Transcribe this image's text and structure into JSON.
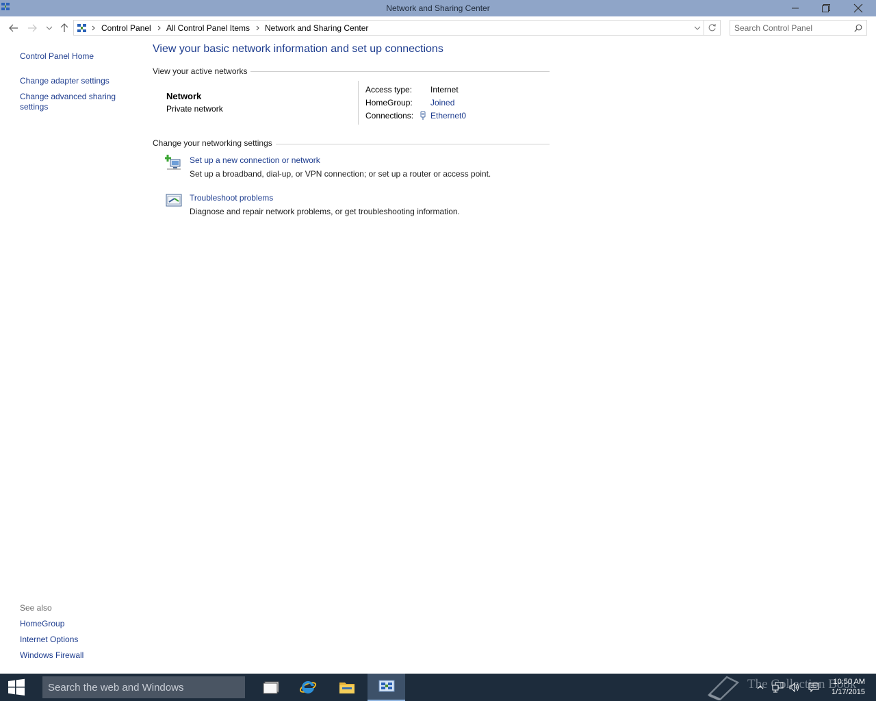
{
  "window": {
    "title": "Network and Sharing Center"
  },
  "address": {
    "crumbs": [
      "Control Panel",
      "All Control Panel Items",
      "Network and Sharing Center"
    ]
  },
  "search": {
    "placeholder": "Search Control Panel"
  },
  "leftnav": {
    "home": "Control Panel Home",
    "adapter": "Change adapter settings",
    "advanced_line1": "Change advanced sharing",
    "advanced_line2": "settings"
  },
  "seealso": {
    "header": "See also",
    "items": [
      "HomeGroup",
      "Internet Options",
      "Windows Firewall"
    ]
  },
  "main": {
    "title": "View your basic network information and set up connections",
    "active_header": "View your active networks",
    "network_name": "Network",
    "network_type": "Private network",
    "access_label": "Access type:",
    "access_value": "Internet",
    "homegroup_label": "HomeGroup:",
    "homegroup_value": "Joined",
    "connections_label": "Connections:",
    "connections_value": "Ethernet0",
    "change_header": "Change your networking settings",
    "tasks": [
      {
        "link": "Set up a new connection or network",
        "desc": "Set up a broadband, dial-up, or VPN connection; or set up a router or access point."
      },
      {
        "link": "Troubleshoot problems",
        "desc": "Diagnose and repair network problems, or get troubleshooting information."
      }
    ]
  },
  "taskbar": {
    "search_placeholder": "Search the web and Windows",
    "watermark": "The Collection Book",
    "time": "10:50 AM",
    "date": "1/17/2015"
  },
  "colors": {
    "titlebar": "#8fa5c8",
    "link": "#1e3d8f",
    "taskbar": "#1d2c3c"
  }
}
